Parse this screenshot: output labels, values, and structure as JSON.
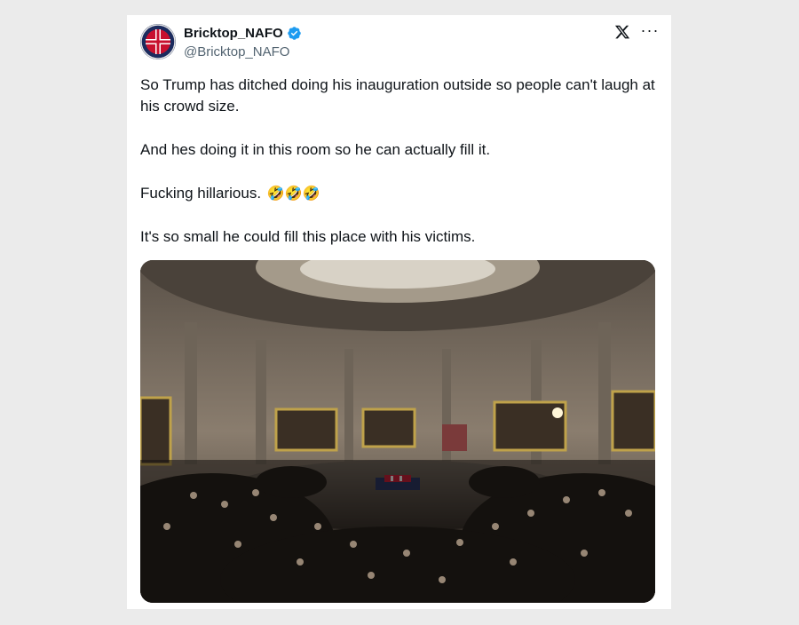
{
  "post": {
    "display_name": "Bricktop_NAFO",
    "handle": "@Bricktop_NAFO",
    "verified_icon": "verified-badge-icon",
    "paragraphs": [
      "So Trump has ditched doing his inauguration outside so people can't laugh at his crowd size.",
      "And hes doing it in this room so he can actually fill it.",
      "Fucking hillarious.",
      "It's so small he could fill this place with his victims."
    ],
    "emoji": "🤣🤣🤣",
    "media_icon": "photo-rotunda-crowd"
  },
  "toolbar": {
    "x_logo": "x-logo-icon",
    "more_icon": "more-options-icon",
    "more_glyph": "···"
  },
  "colors": {
    "text": "#0f1419",
    "secondary": "#536471",
    "verified": "#1d9bf0",
    "background": "#ebebeb"
  }
}
